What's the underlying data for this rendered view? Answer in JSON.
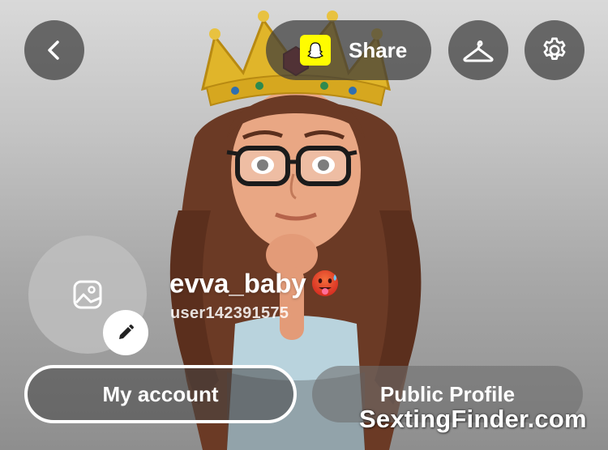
{
  "header": {
    "back_icon": "chevron-left-icon",
    "share_label": "Share",
    "snapcode_icon": "snapcode-ghost-icon",
    "outfit_icon": "hanger-icon",
    "settings_icon": "gear-icon"
  },
  "profile": {
    "display_name": "evva_baby",
    "display_name_emoji": "hot-face-emoji",
    "username": "user142391575",
    "bitmoji_placeholder_icon": "image-icon",
    "edit_icon": "pencil-icon"
  },
  "actions": {
    "my_account_label": "My account",
    "public_profile_label": "Public Profile"
  },
  "watermark": "SextingFinder.com",
  "colors": {
    "snapchat_yellow": "#FFFC00",
    "button_dark": "#3C3C3C",
    "text_white": "#FFFFFF"
  }
}
